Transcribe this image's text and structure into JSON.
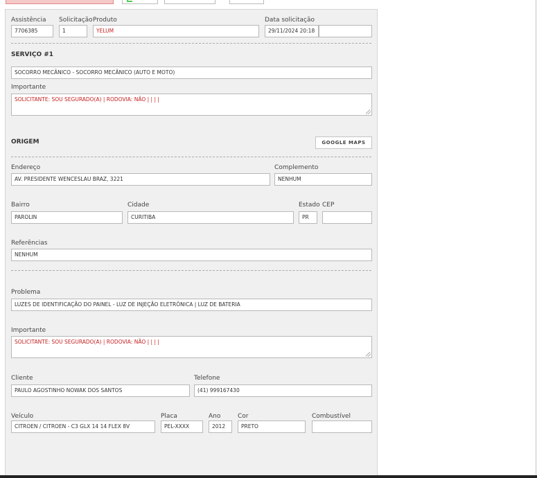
{
  "fields": {
    "assistencia": {
      "label": "Assistência",
      "value": "7706385"
    },
    "solicitacao": {
      "label": "Solicitação",
      "value": "1"
    },
    "produto": {
      "label": "Produto",
      "value": "YELUM"
    },
    "data_solicitacao": {
      "label": "Data solicitação",
      "value": "29/11/2024 20:18",
      "extra": ""
    }
  },
  "servico": {
    "title": "SERVIÇO #1",
    "value": "SOCORRO MECÂNICO - SOCORRO MECÂNICO (AUTO E MOTO)",
    "importante_label": "Importante",
    "importante_value": "SOLICITANTE: SOU SEGURADO(A) | RODOVIA: NÃO |  |  |  |"
  },
  "origem": {
    "title": "ORIGEM",
    "google_maps_label": "GOOGLE MAPS",
    "endereco": {
      "label": "Endereço",
      "value": "AV. PRESIDENTE WENCESLAU BRAZ, 3221"
    },
    "complemento": {
      "label": "Complemento",
      "value": "NENHUM"
    },
    "bairro": {
      "label": "Bairro",
      "value": "PAROLIN"
    },
    "cidade": {
      "label": "Cidade",
      "value": "CURITIBA"
    },
    "estado": {
      "label": "Estado",
      "value": "PR"
    },
    "cep": {
      "label": "CEP",
      "value": ""
    },
    "referencias": {
      "label": "Referências",
      "value": "NENHUM"
    }
  },
  "problema": {
    "label": "Problema",
    "value": "LUZES DE IDENTIFICAÇÃO DO PAINEL - LUZ DE INJEÇÃO ELETRÔNICA | LUZ DE BATERIA",
    "importante_label": "Importante",
    "importante_value": "SOLICITANTE: SOU SEGURADO(A) | RODOVIA: NÃO |  |  |  |"
  },
  "cliente": {
    "cliente": {
      "label": "Cliente",
      "value": "PAULO AGOSTINHO NOWAK DOS SANTOS"
    },
    "telefone": {
      "label": "Telefone",
      "value": "(41) 999167430"
    }
  },
  "veiculo": {
    "veiculo": {
      "label": "Veículo",
      "value": "CITROEN / CITROEN - C3 GLX 14 14 FLEX 8V"
    },
    "placa": {
      "label": "Placa",
      "value": "PEL-XXXX"
    },
    "ano": {
      "label": "Ano",
      "value": "2012"
    },
    "cor": {
      "label": "Cor",
      "value": "PRETO"
    },
    "combustivel": {
      "label": "Combustível",
      "value": ""
    }
  },
  "colors": {
    "panel": "#f0f0f0",
    "accent_red": "#c62020",
    "top_button_red": "#f6c9c9"
  }
}
